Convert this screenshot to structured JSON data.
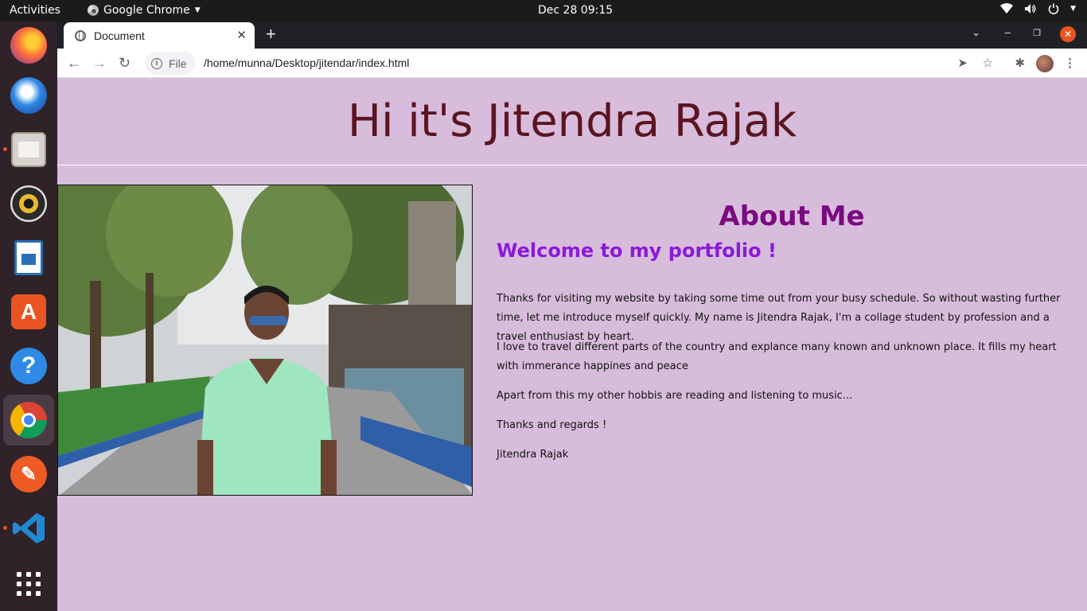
{
  "topbar": {
    "activities": "Activities",
    "app_name": "Google Chrome",
    "clock": "Dec 28  09:15"
  },
  "browser": {
    "tab_title": "Document",
    "chip_label": "File",
    "url": "/home/munna/Desktop/jitendar/index.html"
  },
  "page": {
    "title": "Hi it's Jitendra Rajak",
    "about_heading": "About Me",
    "welcome": "Welcome to my portfolio !",
    "paragraphs": [
      "Thanks for visiting my website by taking some time out from your busy schedule. So without wasting further time, let me introduce myself quickly. My name is Jitendra Rajak, I'm a collage student by profession and a travel enthusiast by heart.",
      "I love to travel different parts of the country and explance many known and unknown place. It fills my heart with immerance happines and peace",
      "Apart from this my other hobbis are reading and listening to music...",
      "Thanks and regards !",
      "Jitendra Rajak"
    ]
  },
  "dock": {
    "items": [
      "firefox-icon",
      "thunderbird-icon",
      "files-icon",
      "rhythmbox-icon",
      "libreoffice-writer-icon",
      "software-center-icon",
      "help-icon",
      "chrome-icon",
      "postman-icon",
      "vscode-icon",
      "show-apps-icon"
    ]
  },
  "colors": {
    "page_bg": "#d8bcdb",
    "title": "#5a1520",
    "about": "#7a0a80",
    "welcome": "#8a1ad8",
    "accent": "#e95420"
  }
}
